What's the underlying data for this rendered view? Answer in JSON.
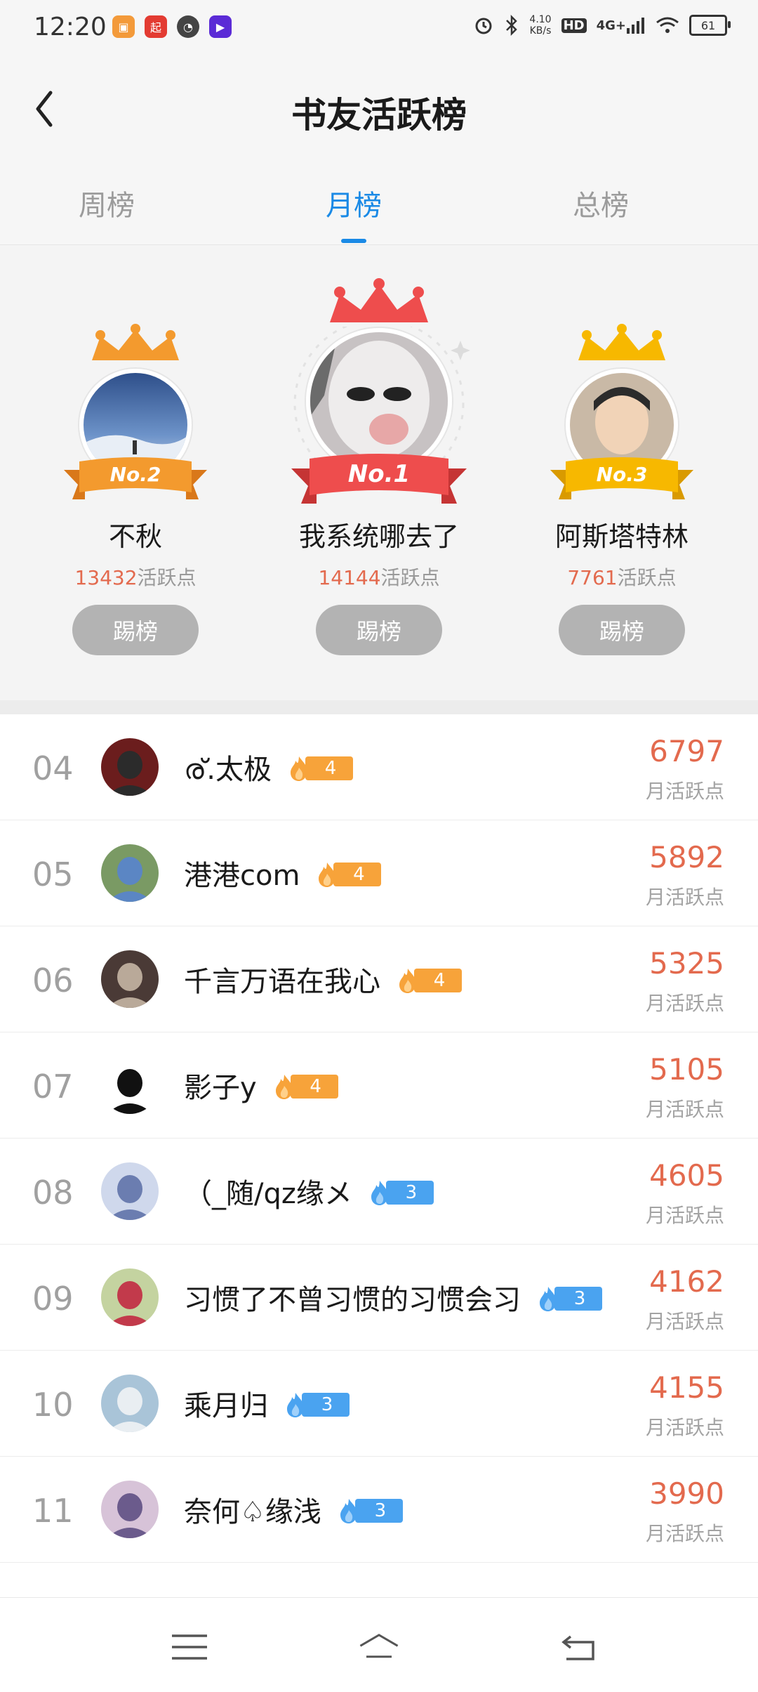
{
  "status_bar": {
    "time": "12:20",
    "speed_value": "4.10",
    "speed_unit": "KB/s",
    "hd": "HD",
    "network": "4G+",
    "battery": "61"
  },
  "header": {
    "title": "书友活跃榜"
  },
  "tabs": [
    {
      "label": "周榜",
      "active": false
    },
    {
      "label": "月榜",
      "active": true
    },
    {
      "label": "总榜",
      "active": false
    }
  ],
  "podium": [
    {
      "rank_badge": "No.2",
      "name": "不秋",
      "points": "13432",
      "unit": "活跃点",
      "button": "踢榜"
    },
    {
      "rank_badge": "No.1",
      "name": "我系统哪去了",
      "points": "14144",
      "unit": "活跃点",
      "button": "踢榜"
    },
    {
      "rank_badge": "No.3",
      "name": "阿斯塔特林",
      "points": "7761",
      "unit": "活跃点",
      "button": "踢榜"
    }
  ],
  "list": [
    {
      "rank": "04",
      "name": "ര്.太极",
      "level": "4",
      "level_color": "orange",
      "points": "6797",
      "unit": "月活跃点"
    },
    {
      "rank": "05",
      "name": "港港com",
      "level": "4",
      "level_color": "orange",
      "points": "5892",
      "unit": "月活跃点"
    },
    {
      "rank": "06",
      "name": "千言万语在我心",
      "level": "4",
      "level_color": "orange",
      "points": "5325",
      "unit": "月活跃点"
    },
    {
      "rank": "07",
      "name": "影子y",
      "level": "4",
      "level_color": "orange",
      "points": "5105",
      "unit": "月活跃点"
    },
    {
      "rank": "08",
      "name": "（_随/qz缘メ",
      "level": "3",
      "level_color": "blue",
      "points": "4605",
      "unit": "月活跃点"
    },
    {
      "rank": "09",
      "name": "习惯了不曾习惯的习惯会习",
      "level": "3",
      "level_color": "blue",
      "points": "4162",
      "unit": "月活跃点"
    },
    {
      "rank": "10",
      "name": "乘月归",
      "level": "3",
      "level_color": "blue",
      "points": "4155",
      "unit": "月活跃点"
    },
    {
      "rank": "11",
      "name": "奈何♤缘浅",
      "level": "3",
      "level_color": "blue",
      "points": "3990",
      "unit": "月活跃点"
    }
  ],
  "colors": {
    "accent": "#1a8ae6",
    "points": "#e36a4e",
    "gold": "#f7a33a",
    "silver_ribbon": "#f08a1e",
    "first_ribbon": "#e84a4a",
    "third_ribbon": "#f7b200",
    "level_orange": "#f7a33a",
    "level_blue": "#4aa3f0"
  },
  "nav": {
    "menu": "menu-icon",
    "home": "home-icon",
    "back": "back-icon"
  }
}
